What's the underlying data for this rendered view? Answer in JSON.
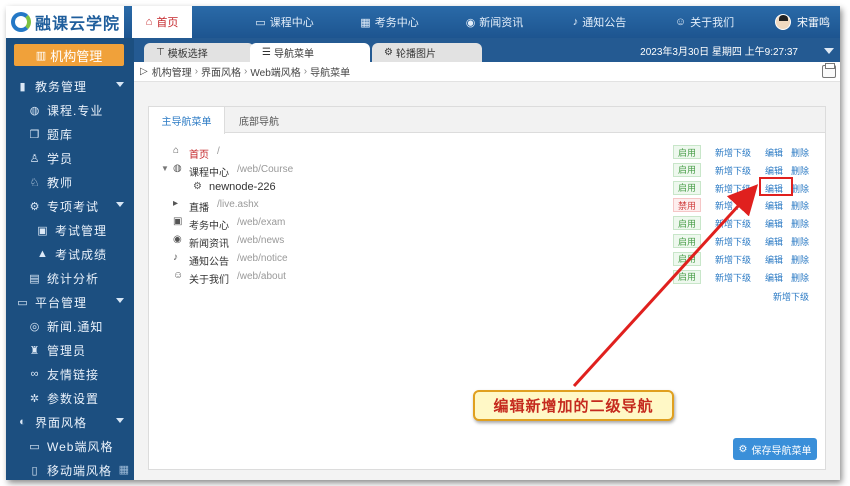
{
  "app": {
    "title": "融课云学院"
  },
  "top_nav": [
    {
      "label": "首页",
      "icon": "home-icon"
    },
    {
      "label": "课程中心",
      "icon": "monitor-icon"
    },
    {
      "label": "考务中心",
      "icon": "calendar-icon"
    },
    {
      "label": "新闻资讯",
      "icon": "eye-icon"
    },
    {
      "label": "通知公告",
      "icon": "bell-icon"
    },
    {
      "label": "关于我们",
      "icon": "people-icon"
    }
  ],
  "user": {
    "name": "宋雷鸣"
  },
  "sidebar": {
    "org_button": "机构管理",
    "items": [
      {
        "label": "教务管理",
        "level": 0,
        "icon": "bar-chart-icon",
        "expandable": true
      },
      {
        "label": "课程.专业",
        "level": 1,
        "icon": "book-icon"
      },
      {
        "label": "题库",
        "level": 1,
        "icon": "copy-icon"
      },
      {
        "label": "学员",
        "level": 1,
        "icon": "user-icon"
      },
      {
        "label": "教师",
        "level": 1,
        "icon": "teacher-icon"
      },
      {
        "label": "专项考试",
        "level": 1,
        "icon": "gear-icon",
        "expandable": true
      },
      {
        "label": "考试管理",
        "level": 2,
        "icon": "exam-icon"
      },
      {
        "label": "考试成绩",
        "level": 2,
        "icon": "chart-icon"
      },
      {
        "label": "统计分析",
        "level": 1,
        "icon": "stats-icon"
      },
      {
        "label": "平台管理",
        "level": 0,
        "icon": "monitor-icon",
        "expandable": true
      },
      {
        "label": "新闻.通知",
        "level": 1,
        "icon": "globe-icon"
      },
      {
        "label": "管理员",
        "level": 1,
        "icon": "admin-icon"
      },
      {
        "label": "友情链接",
        "level": 1,
        "icon": "link-icon"
      },
      {
        "label": "参数设置",
        "level": 1,
        "icon": "settings-icon"
      },
      {
        "label": "界面风格",
        "level": 0,
        "icon": "theme-icon",
        "expandable": true
      },
      {
        "label": "Web端风格",
        "level": 1,
        "icon": "desktop-icon"
      },
      {
        "label": "移动端风格",
        "level": 1,
        "icon": "mobile-icon"
      }
    ]
  },
  "tabs": [
    {
      "label": "模板选择",
      "icon": "shirt-icon"
    },
    {
      "label": "导航菜单",
      "icon": "menu-icon"
    },
    {
      "label": "轮播图片",
      "icon": "gear-icon"
    }
  ],
  "datetime": "2023年3月30日 星期四 上午9:27:37",
  "breadcrumb": [
    "机构管理",
    "界面风格",
    "Web端风格",
    "导航菜单"
  ],
  "subtabs": [
    "主导航菜单",
    "底部导航"
  ],
  "nav_rows": [
    {
      "name": "首页",
      "path": "/",
      "status": "启用",
      "enabled": true,
      "depth": 0,
      "icon": "home-icon",
      "expandable": false
    },
    {
      "name": "课程中心",
      "path": "/web/Course",
      "status": "启用",
      "enabled": true,
      "depth": 0,
      "icon": "course-icon",
      "expandable": true
    },
    {
      "name": "newnode-226",
      "path": "",
      "status": "启用",
      "enabled": true,
      "depth": 1,
      "icon": "node-icon",
      "expandable": false
    },
    {
      "name": "直播",
      "path": "/live.ashx",
      "status": "禁用",
      "enabled": false,
      "depth": 0,
      "icon": "play-icon",
      "expandable": false
    },
    {
      "name": "考务中心",
      "path": "/web/exam",
      "status": "启用",
      "enabled": true,
      "depth": 0,
      "icon": "exam-icon",
      "expandable": false
    },
    {
      "name": "新闻资讯",
      "path": "/web/news",
      "status": "启用",
      "enabled": true,
      "depth": 0,
      "icon": "eye-icon",
      "expandable": false
    },
    {
      "name": "通知公告",
      "path": "/web/notice",
      "status": "启用",
      "enabled": true,
      "depth": 0,
      "icon": "bell-icon",
      "expandable": false
    },
    {
      "name": "关于我们",
      "path": "/web/about",
      "status": "启用",
      "enabled": true,
      "depth": 0,
      "icon": "people-icon",
      "expandable": false
    }
  ],
  "actions": {
    "add_child": "新增下级",
    "edit": "编辑",
    "delete": "删除"
  },
  "add_child_bottom": "新增下级",
  "save_button": "保存导航菜单",
  "annotation": {
    "text": "编辑新增加的二级导航"
  },
  "colors": {
    "sidebar_bg": "#1c4f80",
    "accent_orange": "#f0a13a",
    "link_blue": "#2b7ac4",
    "annotation_red": "#e0201e"
  }
}
